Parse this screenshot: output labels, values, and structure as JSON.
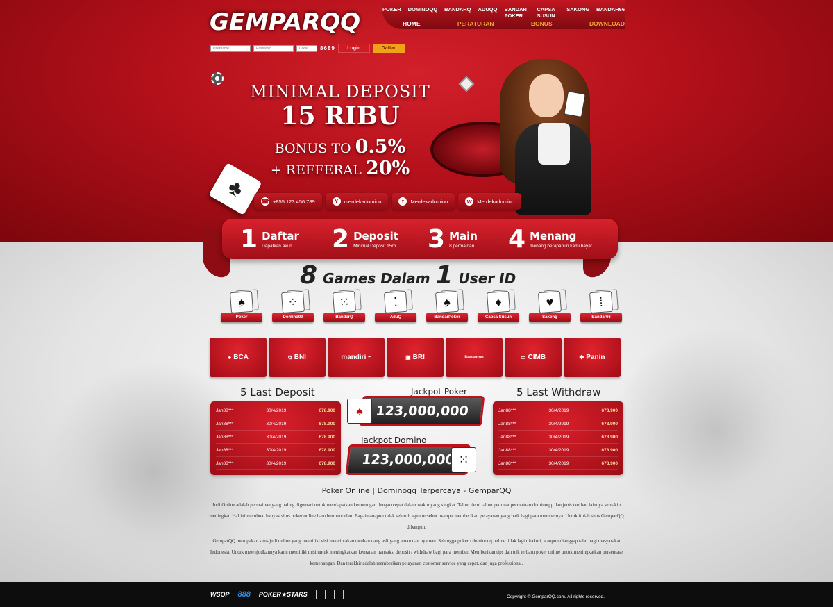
{
  "brand": {
    "logo": "GEMPARQQ"
  },
  "topnav": {
    "games": [
      "POKER",
      "DOMINOQQ",
      "BANDARQ",
      "ADUQQ",
      "BANDAR POKER",
      "CAPSA SUSUN",
      "SAKONG",
      "BANDAR66"
    ],
    "main": [
      "HOME",
      "PERATURAN",
      "BONUS",
      "DOWNLOAD"
    ]
  },
  "login": {
    "username_placeholder": "Username",
    "password_placeholder": "Password",
    "captcha_placeholder": "Code",
    "captcha": "8689",
    "login_label": "Login",
    "register_label": "Daftar"
  },
  "promo": {
    "line1": "MINIMAL DEPOSIT",
    "line2": "15 RIBU",
    "line3_text": "BONUS TO",
    "line3_value": "0.5%",
    "line4_text": "+ REFFERAL",
    "line4_value": "20%"
  },
  "contacts": [
    {
      "icon": "phone-icon",
      "text": "+855 123 456 789"
    },
    {
      "icon": "yahoo-icon",
      "text": "merdekadomino"
    },
    {
      "icon": "twitter-icon",
      "text": "Merdekadomino"
    },
    {
      "icon": "wechat-icon",
      "text": "Merdekadomino"
    }
  ],
  "steps": [
    {
      "num": "1",
      "title": "Daftar",
      "sub": "Dapatkan akun"
    },
    {
      "num": "2",
      "title": "Deposit",
      "sub": "Minimal Deposit 15rb"
    },
    {
      "num": "3",
      "title": "Main",
      "sub": "8 permainan"
    },
    {
      "num": "4",
      "title": "Menang",
      "sub": "menang berapapun kami bayar"
    }
  ],
  "games_title": {
    "n1": "8",
    "t1": "Games Dalam",
    "n2": "1",
    "t2": "User ID"
  },
  "games": [
    "Poker",
    "Domino99",
    "BandarQ",
    "AduQ",
    "BandarPoker",
    "Capsa Susun",
    "Sakong",
    "Bandar66"
  ],
  "banks": [
    "BCA",
    "BNI",
    "mandiri",
    "BRI",
    "Danamon",
    "CIMB",
    "Panin"
  ],
  "deposit": {
    "title": "5 Last Deposit",
    "rows": [
      [
        "Jan88***",
        "30/4/2019",
        "678.900"
      ],
      [
        "Jan88***",
        "30/4/2019",
        "678.900"
      ],
      [
        "Jan88***",
        "30/4/2019",
        "678.900"
      ],
      [
        "Jan88***",
        "30/4/2019",
        "678.900"
      ],
      [
        "Jan88***",
        "30/4/2019",
        "678.900"
      ]
    ]
  },
  "withdraw": {
    "title": "5 Last Withdraw",
    "rows": [
      [
        "Jan88***",
        "30/4/2019",
        "678.900"
      ],
      [
        "Jan88***",
        "30/4/2019",
        "678.900"
      ],
      [
        "Jan88***",
        "30/4/2019",
        "678.900"
      ],
      [
        "Jan88***",
        "30/4/2019",
        "678.900"
      ],
      [
        "Jan88***",
        "30/4/2019",
        "678.900"
      ]
    ]
  },
  "jackpot": {
    "poker_title": "Jackpot Poker",
    "poker_value": "123,000,000",
    "domino_title": "Jackpot Domino",
    "domino_value": "123,000,000"
  },
  "article": {
    "title": "Poker Online | Dominoqq Terpercaya - GemparQQ",
    "p1": "Judi Online adalah permainan yang paling digemari untuk mendapatkan keuntungan dengan cepat dalam waktu yang singkat. Tahun demi tahun peminat permainan dominoqq, dan jenis taruhan lainnya semakin meningkat. Hal ini membuat banyak situs poker online baru bermunculan. Bagaimanapun tidak seluruh agen tersebut mampu memberikan pelayanan yang baik bagi para membernya. Untuk itulah situs GemparQQ dibangun.",
    "p2": "GemparQQ merupakan situs judi online yang memiliki visi menciptakan taruhan uang asli yang aman dan nyaman. Sehingga poker / dominoqq online tidak lagi ditakuti, ataupun dianggap tabu bagi masyarakat Indonesia. Untuk mewujudkannya kami memiliki misi untuk meningkatkan kemanan transaksi deposit / withdraw bagi para member. Memberikan tips dan trik terbaru poker online untuk meningkatkan persentase kemenangan. Dan terakhir adalah memberikan pelayanan customer service yang cepat, dan juga professional."
  },
  "footer": {
    "logos": [
      "WSOP",
      "888",
      "POKER★STARS"
    ],
    "copyright": "Copyright © GemparQQ.com. All rights reserved."
  }
}
